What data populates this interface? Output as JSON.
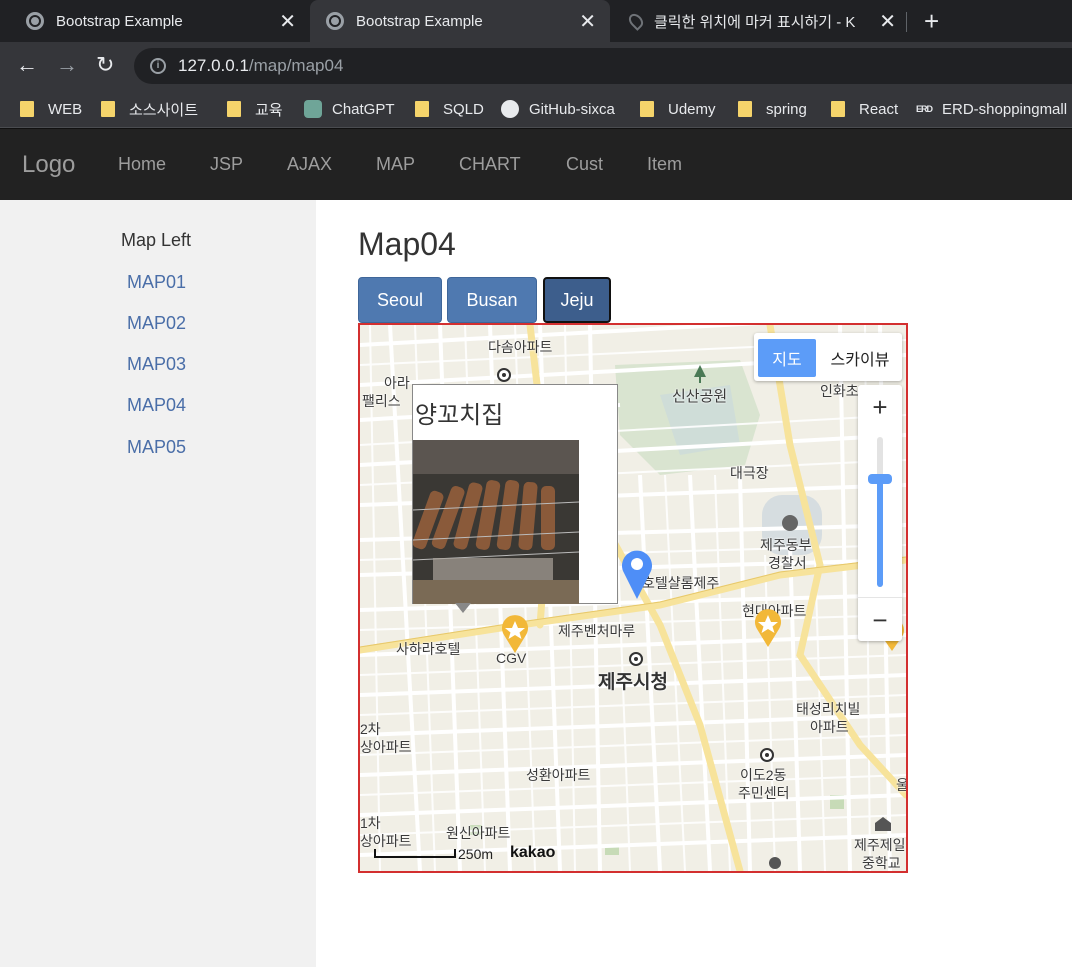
{
  "browser": {
    "tabs": [
      {
        "title": "Bootstrap Example",
        "close": "✕"
      },
      {
        "title": "Bootstrap Example",
        "close": "✕"
      },
      {
        "title": "클릭한 위치에 마커 표시하기 - K",
        "close": "✕"
      }
    ],
    "new_tab": "+",
    "back": "←",
    "forward": "→",
    "reload": "↻",
    "url_host": "127.0.0.1",
    "url_path": "/map/map04",
    "bookmarks": [
      "WEB",
      "소스사이트",
      "교육",
      "ChatGPT",
      "SQLD",
      "GitHub-sixca",
      "Udemy",
      "spring",
      "React",
      "ERD-shoppingmall"
    ],
    "erd_badge": "ERD"
  },
  "navbar": {
    "brand": "Logo",
    "items": [
      "Home",
      "JSP",
      "AJAX",
      "MAP",
      "CHART",
      "Cust",
      "Item"
    ]
  },
  "sidebar": {
    "title": "Map Left",
    "links": [
      "MAP01",
      "MAP02",
      "MAP03",
      "MAP04",
      "MAP05"
    ]
  },
  "main": {
    "title": "Map04",
    "buttons": [
      "Seoul",
      "Busan",
      "Jeju"
    ],
    "active_button": "Jeju"
  },
  "map": {
    "type_map": "지도",
    "type_sky": "스카이뷰",
    "zoom_in": "+",
    "zoom_out": "−",
    "zoom_level_fraction": 0.72,
    "info_title": "양꼬치집",
    "scale": "250m",
    "provider": "kakao",
    "labels": {
      "dasom": "다솜아파트",
      "shinsan": "신산공원",
      "inhwa": "인화초",
      "ara": "아라",
      "palace": "팰리스",
      "daegeuk": "대극장",
      "police1": "제주동부",
      "police2": "경찰서",
      "hotel": "호텔샬롬제주",
      "hyundai": "현대아파트",
      "sahara": "사하라호텔",
      "cgv": "CGV",
      "venture": "제주벤처마루",
      "cityhall": "제주시청",
      "taesung1": "태성리치빌",
      "taesung2": "아파트",
      "apt2cha1": "2차",
      "apt2cha2": "상아파트",
      "seonghwan": "성환아파트",
      "ido1": "이도2동",
      "ido2": "주민센터",
      "apt1cha1": "1차",
      "apt1cha2": "상아파트",
      "wonsin": "원신아파트",
      "jeil1": "제주제일",
      "jeil2": "중학교",
      "ul": "울"
    }
  },
  "colors": {
    "navbar_bg": "#222222",
    "button_bg": "#4f79b0",
    "map_border": "#d32f2f",
    "accent_blue": "#5c9cf8",
    "star_marker": "#f2b838"
  }
}
